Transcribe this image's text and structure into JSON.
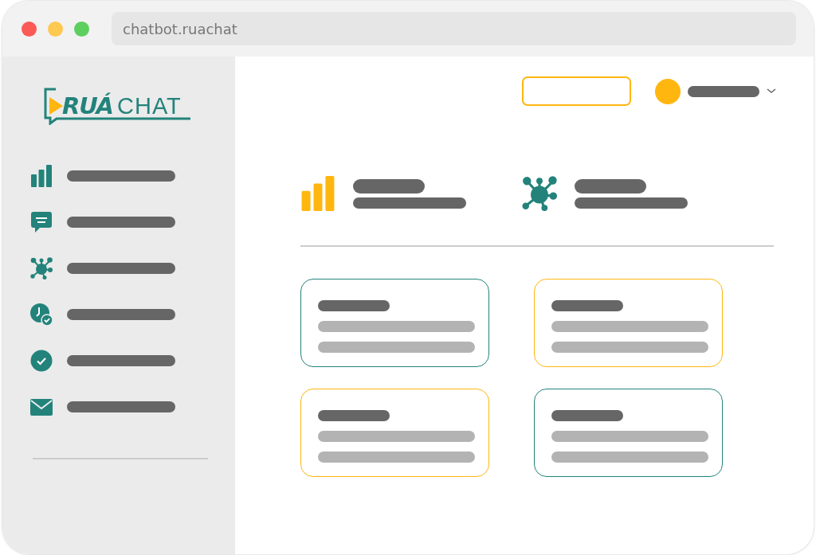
{
  "window": {
    "address": "chatbot.ruachat"
  },
  "logo": {
    "bold": "RUÁ",
    "light": "CHAT"
  },
  "sidebar": {
    "items": [
      {
        "kind": "bars"
      },
      {
        "kind": "chat"
      },
      {
        "kind": "network"
      },
      {
        "kind": "clock"
      },
      {
        "kind": "check"
      },
      {
        "kind": "mail"
      }
    ]
  },
  "stats": [
    {
      "kind": "bars",
      "color": "#ffb60f"
    },
    {
      "kind": "network",
      "color": "#23837b"
    }
  ],
  "cards": [
    {
      "color": "#23837b"
    },
    {
      "color": "#ffb60f"
    },
    {
      "color": "#ffb60f"
    },
    {
      "color": "#23837b"
    }
  ]
}
